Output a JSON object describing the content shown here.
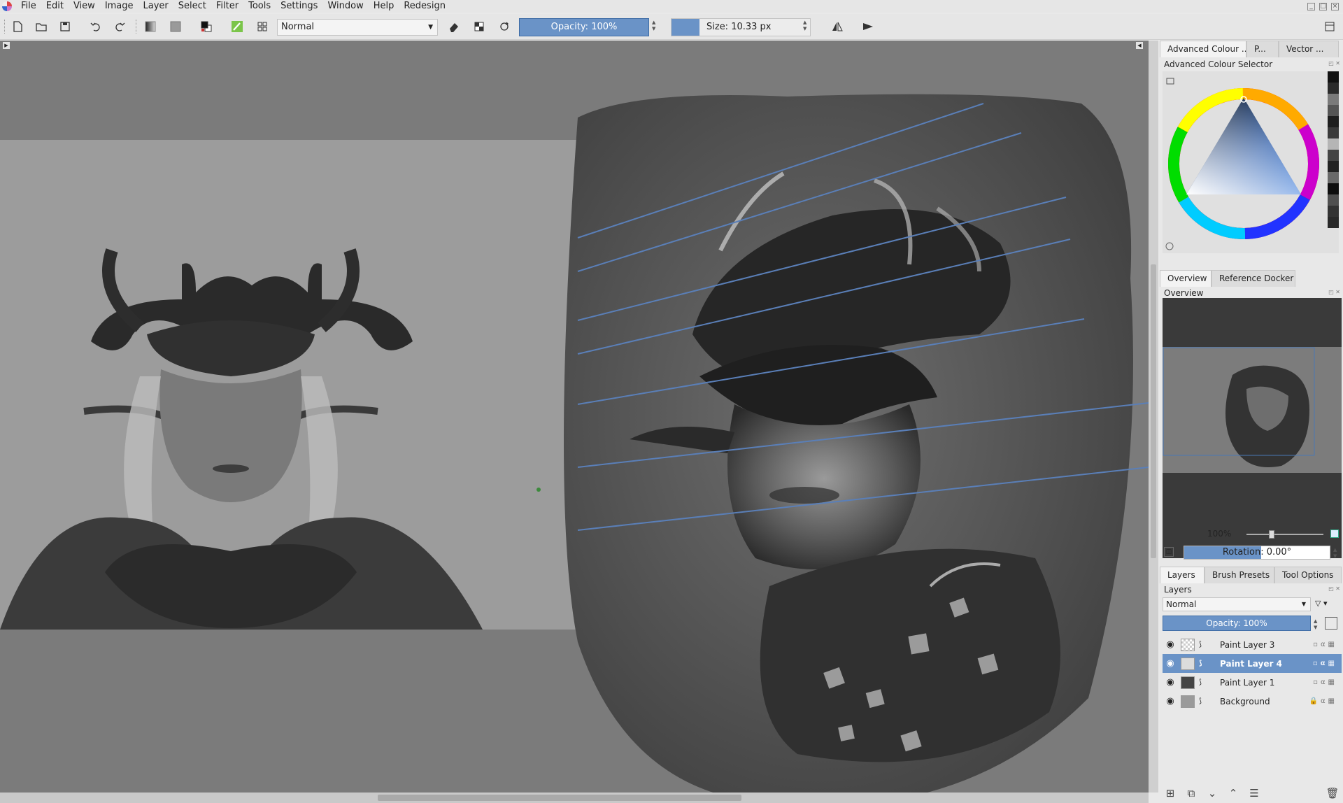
{
  "menubar": {
    "items": [
      "File",
      "Edit",
      "View",
      "Image",
      "Layer",
      "Select",
      "Filter",
      "Tools",
      "Settings",
      "Window",
      "Help",
      "Redesign"
    ]
  },
  "toolbar": {
    "blend_mode": "Normal",
    "opacity_label": "Opacity: 100%",
    "size_label": "Size: 10.33 px"
  },
  "dockers": {
    "top_tabs": [
      "Advanced Colour ...",
      "P...",
      "Vector ..."
    ],
    "colour_selector_title": "Advanced Colour Selector",
    "mid_tabs": [
      "Overview",
      "Reference Docker"
    ],
    "overview_title": "Overview",
    "zoom_label": "100%",
    "rotation_label": "Rotation: 0.00°",
    "bottom_tabs": [
      "Layers",
      "Brush Presets",
      "Tool Options"
    ],
    "layers_title": "Layers"
  },
  "layers": {
    "blend_mode": "Normal",
    "opacity_label": "Opacity:  100%",
    "items": [
      {
        "name": "Paint Layer 3",
        "active": false
      },
      {
        "name": "Paint Layer 4",
        "active": true
      },
      {
        "name": "Paint Layer 1",
        "active": false
      },
      {
        "name": "Background",
        "active": false
      }
    ]
  },
  "colors": {
    "accent": "#6a93c7",
    "canvas_bg": "#7b7b7b",
    "guide_lines": "#5a7fb8"
  }
}
